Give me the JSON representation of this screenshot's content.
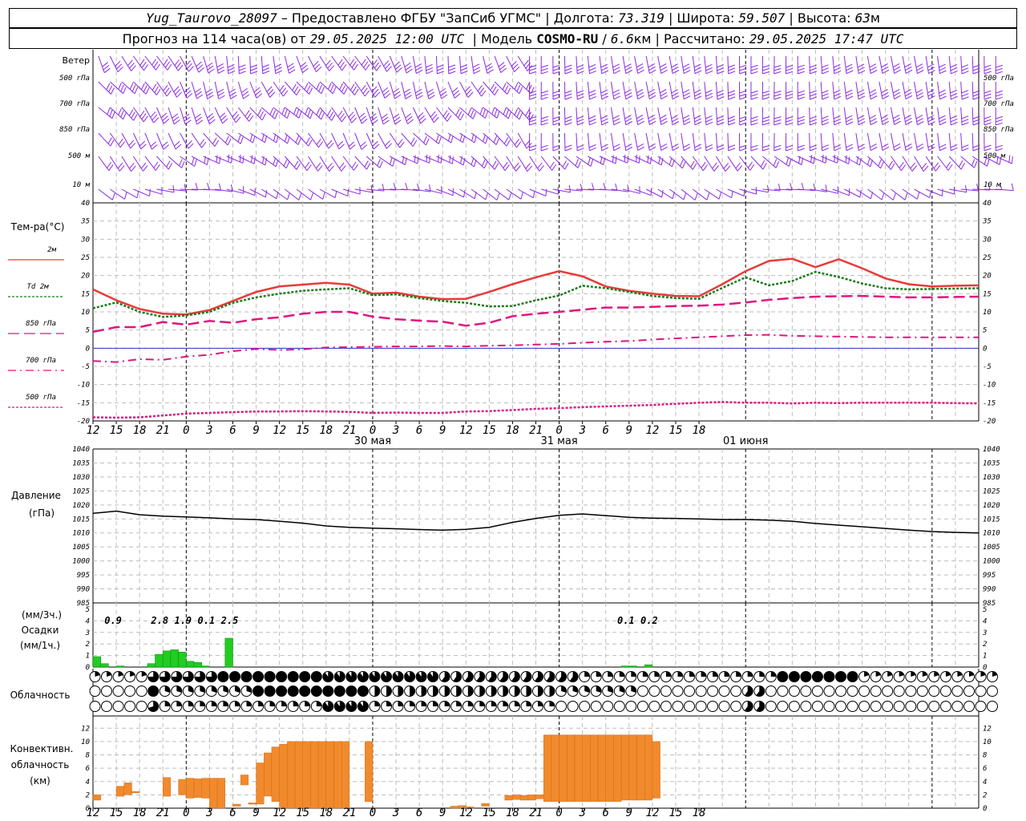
{
  "header": {
    "station": "Yug_Taurovo_28097",
    "provider_text": "– Предоставлено ФГБУ \"ЗапСиб УГМС\"",
    "lon_label": "Долгота:",
    "lon": "73.319",
    "lat_label": "Широта:",
    "lat": "59.507",
    "alt_label": "Высота:",
    "alt": "63",
    "alt_unit": "м",
    "forecast_prefix": "Прогноз на 114 часа(ов) от",
    "forecast_date": "29.05.2025 12:00 UTC",
    "model_label": "Модель",
    "model": "COSMO-RU",
    "resolution": "6.6",
    "resolution_unit": "км",
    "calc_label": "Рассчитано:",
    "calc_date": "29.05.2025 17:47 UTC"
  },
  "time_axis": {
    "hour_labels": [
      "12",
      "15",
      "18",
      "21",
      "0",
      "3",
      "6",
      "9",
      "12",
      "15",
      "18",
      "21",
      "0",
      "3",
      "6",
      "9",
      "12",
      "15",
      "18",
      "21",
      "0",
      "3",
      "6",
      "9",
      "12",
      "15",
      "18"
    ],
    "day_labels": [
      "30 мая",
      "31 мая",
      "01 июня"
    ],
    "start_hour": 12,
    "step_hours": 3
  },
  "wind_panel": {
    "title": "Ветер",
    "levels": [
      "500 гПа",
      "700 гПа",
      "850 гПа",
      "500 м",
      "10 м"
    ],
    "color": "#8a2be2"
  },
  "temperature_panel": {
    "title": "Тем-ра(°С)",
    "legend": [
      "2м",
      "Td 2м",
      "850 гПа",
      "700 гПа",
      "500 гПа"
    ],
    "ticks": [
      40,
      35,
      30,
      25,
      20,
      15,
      10,
      5,
      0,
      -5,
      -10,
      -15,
      -20
    ]
  },
  "pressure_panel": {
    "title_line1": "Давление",
    "title_line2": "(гПа)",
    "ticks": [
      1040,
      1035,
      1030,
      1025,
      1020,
      1015,
      1010,
      1005,
      1000,
      995,
      990,
      985
    ]
  },
  "precip_panel": {
    "title_line1": "(мм/3ч.)",
    "title_line2": "Осадки",
    "title_line3": "(мм/1ч.)",
    "ticks": [
      5,
      4,
      3,
      2,
      1,
      0
    ],
    "totals": [
      {
        "x": 3,
        "label": "0.9"
      },
      {
        "x": 9,
        "label": "2.8"
      },
      {
        "x": 12,
        "label": "1.9"
      },
      {
        "x": 15,
        "label": "0.1"
      },
      {
        "x": 18,
        "label": "2.5"
      },
      {
        "x": 69,
        "label": "0.1"
      },
      {
        "x": 72,
        "label": "0.2"
      }
    ]
  },
  "cloud_panel": {
    "title": "Облачность"
  },
  "conv_panel": {
    "title_line1": "Конвективн.",
    "title_line2": "облачность",
    "title_line3": "(км)",
    "ticks": [
      12,
      10,
      8,
      6,
      4,
      2,
      0
    ]
  },
  "colors": {
    "t2m": "#e83a3a",
    "td2m": "#1e7a1e",
    "level": "#e0157f",
    "pressure": "#000000",
    "precip": "#22cc22",
    "conv": "#f08a2c",
    "zero": "#3030d0"
  },
  "chart_data": [
    {
      "type": "line",
      "title": "Тем-ра(°С)",
      "x_unit": "hours since 29.05.2025 12:00 UTC",
      "ylim": [
        -20,
        40
      ],
      "series": [
        {
          "name": "2м",
          "x": [
            0,
            3,
            6,
            9,
            12,
            15,
            18,
            21,
            24,
            27,
            30,
            33,
            36,
            39,
            42,
            45,
            48,
            51,
            54,
            57,
            60,
            63,
            66,
            69,
            72,
            75,
            78,
            81,
            84,
            87,
            90,
            93,
            96,
            99,
            102,
            105,
            108,
            111,
            114
          ],
          "values": [
            16.2,
            13.2,
            10.8,
            9.5,
            9.3,
            10.5,
            13.0,
            15.5,
            17.0,
            17.5,
            18.0,
            17.5,
            15.0,
            15.3,
            14.2,
            13.5,
            13.6,
            15.5,
            17.6,
            19.5,
            21.2,
            19.8,
            17.0,
            15.8,
            15.0,
            14.4,
            14.3,
            17.6,
            21.2,
            24.0,
            24.6,
            22.3,
            24.5,
            22.0,
            19.2,
            17.6,
            17.0,
            17.2,
            17.3
          ]
        },
        {
          "name": "Td 2м",
          "x": [
            0,
            3,
            6,
            9,
            12,
            15,
            18,
            21,
            24,
            27,
            30,
            33,
            36,
            39,
            42,
            45,
            48,
            51,
            54,
            57,
            60,
            63,
            66,
            69,
            72,
            75,
            78,
            81,
            84,
            87,
            90,
            93,
            96,
            99,
            102,
            105,
            108,
            111,
            114
          ],
          "values": [
            11.0,
            12.6,
            10.0,
            8.6,
            9.0,
            10.0,
            12.5,
            14.0,
            15.0,
            15.8,
            16.2,
            16.5,
            14.6,
            14.8,
            13.8,
            13.0,
            12.5,
            11.5,
            11.6,
            13.2,
            14.5,
            17.2,
            16.5,
            15.5,
            14.4,
            13.8,
            13.6,
            16.6,
            19.5,
            17.3,
            18.5,
            21.0,
            19.6,
            17.8,
            16.5,
            16.2,
            16.3,
            16.4,
            16.5
          ]
        },
        {
          "name": "850 гПа",
          "x": [
            0,
            3,
            6,
            9,
            12,
            15,
            18,
            21,
            24,
            27,
            30,
            33,
            36,
            39,
            42,
            45,
            48,
            51,
            54,
            57,
            60,
            63,
            66,
            69,
            72,
            75,
            78,
            81,
            84,
            87,
            90,
            93,
            96,
            99,
            102,
            105,
            108,
            111,
            114
          ],
          "values": [
            4.5,
            5.8,
            5.8,
            7.2,
            6.5,
            7.5,
            7.0,
            8.0,
            8.5,
            9.5,
            10.0,
            10.0,
            8.7,
            8.0,
            7.6,
            7.3,
            6.2,
            7.0,
            8.8,
            9.5,
            10.0,
            10.6,
            11.2,
            11.2,
            11.4,
            11.6,
            11.7,
            12.0,
            12.6,
            13.3,
            13.8,
            14.2,
            14.3,
            14.4,
            14.2,
            14.0,
            14.0,
            14.1,
            14.2
          ]
        },
        {
          "name": "700 гПа",
          "x": [
            0,
            3,
            6,
            9,
            12,
            15,
            18,
            21,
            24,
            27,
            30,
            33,
            36,
            39,
            42,
            45,
            48,
            51,
            54,
            57,
            60,
            63,
            66,
            69,
            72,
            75,
            78,
            81,
            84,
            87,
            90,
            93,
            96,
            99,
            102,
            105,
            108,
            111,
            114
          ],
          "values": [
            -3.5,
            -3.8,
            -3.0,
            -3.2,
            -2.3,
            -1.8,
            -0.8,
            -0.2,
            -0.5,
            -0.3,
            0.2,
            0.3,
            0.4,
            0.5,
            0.5,
            0.6,
            0.5,
            0.7,
            0.8,
            1.0,
            1.2,
            1.5,
            1.8,
            2.0,
            2.4,
            2.7,
            3.0,
            3.3,
            3.6,
            3.7,
            3.4,
            3.3,
            3.2,
            3.1,
            3.0,
            3.0,
            3.0,
            3.0,
            3.0
          ]
        },
        {
          "name": "500 гПа",
          "x": [
            0,
            3,
            6,
            9,
            12,
            15,
            18,
            21,
            24,
            27,
            30,
            33,
            36,
            39,
            42,
            45,
            48,
            51,
            54,
            57,
            60,
            63,
            66,
            69,
            72,
            75,
            78,
            81,
            84,
            87,
            90,
            93,
            96,
            99,
            102,
            105,
            108,
            111,
            114
          ],
          "values": [
            -19.0,
            -19.1,
            -19.0,
            -18.5,
            -18.0,
            -17.8,
            -17.6,
            -17.4,
            -17.4,
            -17.3,
            -17.4,
            -17.5,
            -17.8,
            -17.7,
            -17.8,
            -17.8,
            -17.4,
            -17.3,
            -17.0,
            -16.7,
            -16.5,
            -16.2,
            -16.0,
            -15.8,
            -15.6,
            -15.3,
            -15.0,
            -14.8,
            -15.0,
            -15.0,
            -15.2,
            -15.0,
            -15.1,
            -15.0,
            -15.0,
            -15.0,
            -15.0,
            -15.1,
            -15.2
          ]
        }
      ]
    },
    {
      "type": "line",
      "title": "Давление",
      "ylabel": "(гПа)",
      "ylim": [
        985,
        1040
      ],
      "series": [
        {
          "name": "Давление",
          "x": [
            0,
            3,
            6,
            9,
            12,
            15,
            18,
            21,
            24,
            27,
            30,
            33,
            36,
            39,
            42,
            45,
            48,
            51,
            54,
            57,
            60,
            63,
            66,
            69,
            72,
            75,
            78,
            81,
            84,
            87,
            90,
            93,
            96,
            99,
            102,
            105,
            108,
            111,
            114
          ],
          "values": [
            1017.0,
            1017.8,
            1016.5,
            1016.0,
            1015.7,
            1015.4,
            1015.0,
            1014.8,
            1014.2,
            1013.5,
            1012.5,
            1012.0,
            1011.7,
            1011.5,
            1011.2,
            1011.0,
            1011.3,
            1012.0,
            1013.8,
            1015.2,
            1016.3,
            1016.8,
            1016.2,
            1015.6,
            1015.3,
            1015.2,
            1015.0,
            1014.8,
            1014.8,
            1014.6,
            1014.2,
            1013.4,
            1012.8,
            1012.2,
            1011.6,
            1011.0,
            1010.5,
            1010.2,
            1010.0
          ]
        }
      ]
    },
    {
      "type": "bar",
      "title": "Осадки",
      "ylabel": "(мм/1ч.)",
      "ylim": [
        0,
        5
      ],
      "x": [
        1,
        2,
        3,
        4,
        5,
        6,
        7,
        8,
        9,
        10,
        11,
        12,
        13,
        14,
        15,
        16,
        17,
        18,
        19,
        20,
        21,
        22,
        23,
        24,
        25,
        26,
        27,
        28,
        29,
        30,
        31,
        32,
        33,
        34,
        35,
        36,
        37,
        38,
        39,
        40,
        41,
        42,
        43,
        44,
        45,
        46,
        47,
        48,
        49,
        50,
        51,
        52,
        53,
        54,
        55,
        56,
        57,
        58,
        59,
        60,
        61,
        62,
        63,
        64,
        65,
        66,
        67,
        68,
        69,
        70,
        71,
        72,
        73,
        74,
        75,
        76,
        77,
        78
      ],
      "values": [
        0.9,
        0.3,
        0,
        0.1,
        0,
        0,
        0,
        0.3,
        1.1,
        1.4,
        1.5,
        1.3,
        0.5,
        0.4,
        0.1,
        0,
        0,
        2.5,
        0,
        0,
        0,
        0,
        0,
        0,
        0,
        0,
        0,
        0,
        0,
        0,
        0,
        0,
        0,
        0,
        0,
        0,
        0,
        0,
        0,
        0,
        0,
        0,
        0,
        0,
        0,
        0,
        0,
        0,
        0,
        0,
        0,
        0,
        0,
        0,
        0,
        0,
        0,
        0,
        0,
        0,
        0,
        0,
        0,
        0,
        0,
        0,
        0,
        0,
        0.1,
        0.1,
        0,
        0.2,
        0,
        0,
        0,
        0,
        0,
        0
      ]
    },
    {
      "type": "bar",
      "title": "Конвективн. облачность",
      "ylabel": "(км)",
      "ylim": [
        0,
        13
      ],
      "x": [
        1,
        4,
        5,
        6,
        10,
        12,
        13,
        14,
        15,
        16,
        17,
        19,
        20,
        21,
        22,
        23,
        24,
        25,
        26,
        27,
        28,
        29,
        30,
        31,
        32,
        33,
        36,
        47,
        48,
        49,
        51,
        54,
        55,
        56,
        57,
        58,
        59,
        60,
        61,
        62,
        63,
        64,
        65,
        66,
        67,
        68,
        69,
        70,
        71,
        72,
        73
      ],
      "bottom": [
        1.2,
        1.8,
        2.0,
        2.3,
        1.8,
        2.0,
        1.5,
        1.6,
        1.5,
        0,
        0,
        0.3,
        3.5,
        0.6,
        0.6,
        1.8,
        1.0,
        0,
        0,
        0,
        0,
        0,
        0,
        0,
        0,
        0,
        1.0,
        0,
        0,
        0,
        0.3,
        1.2,
        1.3,
        1.2,
        1.2,
        1.4,
        1.0,
        1.0,
        1.0,
        1.0,
        1.0,
        1.0,
        1.0,
        1.0,
        1.0,
        1.0,
        1.2,
        1.2,
        1.2,
        1.2,
        1.5
      ],
      "top": [
        2.0,
        3.3,
        3.8,
        2.5,
        4.6,
        4.3,
        4.5,
        4.4,
        4.5,
        4.5,
        4.5,
        0.6,
        5.0,
        0.8,
        6.8,
        8.3,
        9.2,
        9.6,
        10.0,
        10.0,
        10.0,
        10.0,
        10.0,
        10.0,
        10.0,
        10.0,
        10.0,
        0.3,
        0.4,
        0.2,
        0.7,
        1.9,
        2.0,
        1.9,
        2.0,
        2.0,
        11.0,
        11.0,
        11.0,
        11.0,
        11.0,
        11.0,
        11.0,
        11.0,
        11.0,
        11.0,
        11.0,
        11.0,
        11.0,
        11.0,
        10.0
      ]
    }
  ]
}
